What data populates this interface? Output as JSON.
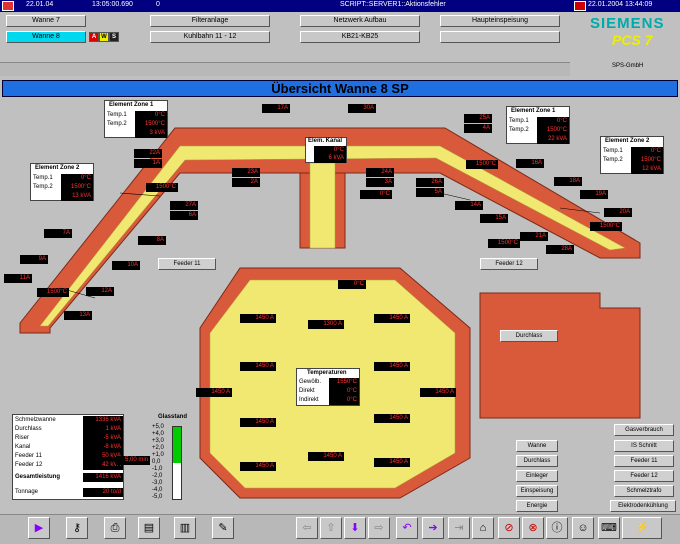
{
  "header": {
    "date": "22.01.04",
    "time": "13:05:00.690",
    "count": "0",
    "script": "SCRIPT::SERVER1::Aktionsfehler",
    "right_date": "22.01.2004 13:44:09",
    "logo": "SIEMENS",
    "product": "PCS 7",
    "company": "SPS-GmbH"
  },
  "nav": {
    "row1": [
      "Wanne 7",
      "Filteranlage",
      "Netzwerk Aufbau",
      "Haupteinspeisung"
    ],
    "row2": [
      "Wanne 8",
      "Kuhlbahn 11 - 12",
      "KB21-KB25",
      ""
    ],
    "flags": [
      "A",
      "W",
      "S"
    ]
  },
  "title": "Übersicht Wanne 8 SP",
  "zones": [
    {
      "name": "Element Zone 1",
      "t1": "0°C",
      "t2": "1500°C",
      "p": "3 kVA"
    },
    {
      "name": "Element Zone 2",
      "t1": "0°C",
      "t2": "1500°C",
      "p": "13 kVA"
    },
    {
      "name": "Element Zone 1",
      "t1": "0°C",
      "t2": "1500°C",
      "p": "22 kVA"
    },
    {
      "name": "Element Zone 2",
      "t1": "0°C",
      "t2": "1500°C",
      "p": "12 kVA"
    }
  ],
  "zone_labels": {
    "t1": "Temp.1",
    "t2": "Temp.2"
  },
  "kanal": {
    "name": "Elem. Kanal",
    "v1": "0°C",
    "v2": "6 kVA"
  },
  "feeders": {
    "f11": "Feeder 11",
    "f12": "Feeder 12",
    "durchlass": "Durchlass"
  },
  "temps": {
    "title": "Temperaturen",
    "rows": [
      {
        "l": "Gewölb.",
        "v": "1550°C"
      },
      {
        "l": "Direkt",
        "v": "0°C"
      },
      {
        "l": "Indirekt",
        "v": "0°C"
      }
    ]
  },
  "channel_vals": [
    "1A",
    "2A",
    "3A",
    "4A",
    "5A",
    "6A",
    "7A",
    "8A",
    "9A",
    "10A",
    "11A",
    "12A",
    "13A",
    "14A",
    "15A",
    "16A",
    "17A",
    "18A",
    "19A",
    "20A",
    "21A",
    "22A",
    "23A",
    "24A",
    "25A",
    "26A",
    "27A",
    "28A",
    "29A",
    "30A",
    "31A",
    "32A",
    "33A",
    "34A",
    "35A",
    "36A",
    "37A",
    "38A",
    "39A",
    "40A"
  ],
  "temp_vals": [
    "0°C",
    "1500°C",
    "1500°C",
    "0°C",
    "1500°C",
    "0°C",
    "1500°C",
    "1500°C"
  ],
  "hex_vals": [
    "1450 A",
    "1300 A",
    "1450 A",
    "1450 A",
    "1450 A",
    "1450 A",
    "1450 A",
    "1450 A",
    "1450 A",
    "1450 A",
    "1450 A",
    "1450 A"
  ],
  "summary": {
    "rows": [
      {
        "l": "Schmelzwanne",
        "v": "1336 kVA"
      },
      {
        "l": "Durchlass",
        "v": "1 kVA"
      },
      {
        "l": "Riser",
        "v": "-5 kVA"
      },
      {
        "l": "Kanal",
        "v": "-8 kVA"
      },
      {
        "l": "Feeder 11",
        "v": "50 kVA"
      },
      {
        "l": "Feeder 12",
        "v": "42 kVA"
      }
    ],
    "total_l": "Gesamtleistung",
    "total_v": "1416 kVA",
    "ton_l": "Tonnage",
    "ton_v": "20 to/d",
    "time": "5,00 min",
    "glass": "Glasstand",
    "scale": [
      "+5,0",
      "+4,0",
      "+3,0",
      "+2,0",
      "+1,0",
      "0,0",
      "-1,0",
      "-2,0",
      "-3,0",
      "-4,0",
      "-5,0"
    ]
  },
  "legend": {
    "items": [
      "Wanne",
      "Durchlass",
      "Einleger",
      "Einspeisung",
      "Energie"
    ],
    "right": [
      "Gasverbrauch",
      "IS Schnitt",
      "Feeder 11",
      "Feeder 12",
      "Schmelztrafo",
      "Elektrodenkühlung"
    ]
  },
  "tags": [
    "1A",
    "1B",
    "1C",
    "1D",
    "1E",
    "1F",
    "1G",
    "1H",
    "1I",
    "1K",
    "1L",
    "1M",
    "2A",
    "2B",
    "2C",
    "2D",
    "2E",
    "2F",
    "2G",
    "2H",
    "2I",
    "2J",
    "2K",
    "2L",
    "2M"
  ]
}
